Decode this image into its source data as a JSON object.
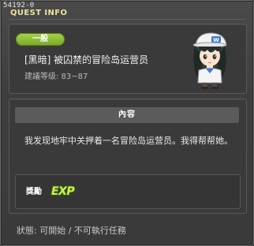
{
  "window": {
    "quest_id": "54192-0",
    "title": "QUEST INFO"
  },
  "quest": {
    "category": "一般",
    "name": "[黑暗] 被囚禁的冒险岛运营员",
    "level_range": "建議等级: 83~87"
  },
  "content": {
    "header": "內容",
    "description": "我发现地牢中关押着一名冒险岛运营员。我得帮帮她。"
  },
  "reward": {
    "label": "獎勵",
    "exp_text": "EXP"
  },
  "status": {
    "prefix": "狀態:",
    "available": "可開始",
    "separator": " / ",
    "not_executable": "不可執行任務"
  },
  "colors": {
    "title": "#f0e39a",
    "badge": "#8fbd35",
    "exp": "#c9f15a"
  },
  "icons": {
    "npc_portrait": "npc-portrait-icon",
    "exp": "exp-icon"
  }
}
